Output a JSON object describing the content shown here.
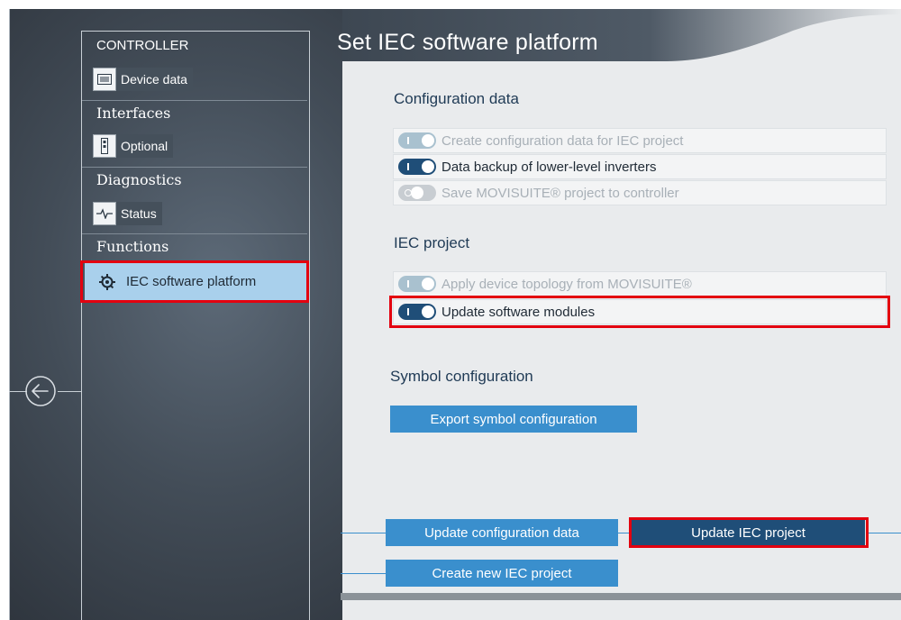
{
  "window": {
    "title": "Set IEC software platform"
  },
  "sidebar": {
    "sections": [
      {
        "header": "CONTROLLER",
        "items": [
          {
            "label": "Device data",
            "icon": "device-data-icon"
          }
        ]
      },
      {
        "header": "Interfaces",
        "items": [
          {
            "label": "Optional",
            "icon": "optional-interface-icon"
          }
        ]
      },
      {
        "header": "Diagnostics",
        "items": [
          {
            "label": "Status",
            "icon": "status-pulse-icon"
          }
        ]
      },
      {
        "header": "Functions",
        "items": [
          {
            "label": "IEC software platform",
            "icon": "iec-platform-icon",
            "selected": true
          }
        ]
      }
    ],
    "back_icon": "back-arrow-icon"
  },
  "configuration": {
    "heading": "Configuration data",
    "options": [
      {
        "label": "Create configuration data for IEC project",
        "state": "on",
        "enabled": false
      },
      {
        "label": "Data backup of lower-level inverters",
        "state": "on",
        "enabled": true
      },
      {
        "label": "Save MOVISUITE® project to controller",
        "state": "off",
        "enabled": false
      }
    ]
  },
  "iec_project": {
    "heading": "IEC project",
    "options": [
      {
        "label": "Apply device topology from MOVISUITE®",
        "state": "on",
        "enabled": false
      },
      {
        "label": "Update software modules",
        "state": "on",
        "enabled": true
      }
    ]
  },
  "symbol": {
    "heading": "Symbol configuration",
    "export_button": "Export symbol configuration"
  },
  "actions": {
    "update_config": "Update configuration data",
    "update_iec": "Update IEC project",
    "create_iec": "Create new IEC project"
  },
  "colors": {
    "accent": "#3a8fcd",
    "accent_dark": "#1f4e78",
    "highlight": "#e3000f",
    "selected_nav": "#a9d0ec"
  }
}
